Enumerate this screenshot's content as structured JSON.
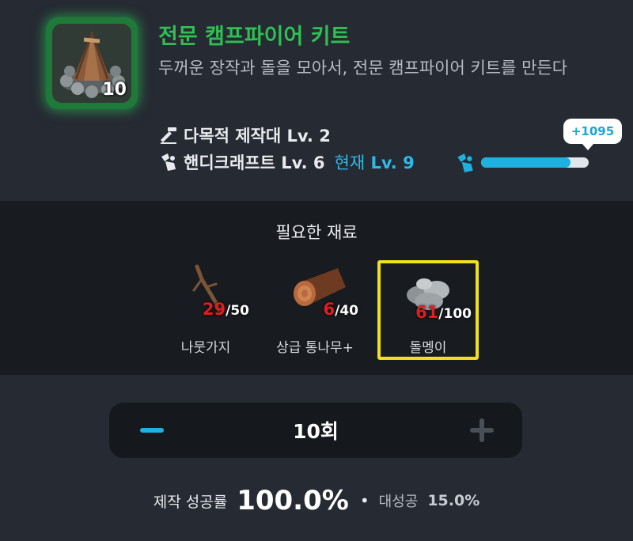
{
  "item": {
    "name": "전문 캠프파이어 키트",
    "description": "두꺼운 장작과 돌을 모아서, 전문 캠프파이어 키트를 만든다",
    "quantity": "10",
    "icon": "campfire-kit-icon"
  },
  "requirements": {
    "workbench": "다목적 제작대 Lv. 2",
    "skill": "핸디크래프트 Lv. 6",
    "current_label": "현재",
    "current_level": "Lv. 9"
  },
  "xp": {
    "gain": "+1095",
    "progress": 0.83
  },
  "materials": {
    "title": "필요한 재료",
    "items": [
      {
        "name": "나뭇가지",
        "have": "29",
        "need": "/50",
        "icon": "branch-icon",
        "selected": false
      },
      {
        "name": "상급 통나무+",
        "have": "6",
        "need": "/40",
        "icon": "log-icon",
        "selected": false
      },
      {
        "name": "돌멩이",
        "have": "61",
        "need": "/100",
        "icon": "stone-icon",
        "selected": true
      }
    ]
  },
  "stepper": {
    "count": "10회"
  },
  "success": {
    "label": "제작 성공률",
    "value": "100.0%",
    "great_label": "대성공",
    "great_value": "15.0%"
  },
  "colors": {
    "title_green": "#2fbf52",
    "accent_blue": "#1db1e0",
    "shortage_red": "#e01e1e",
    "selected_yellow": "#f2e01f"
  }
}
